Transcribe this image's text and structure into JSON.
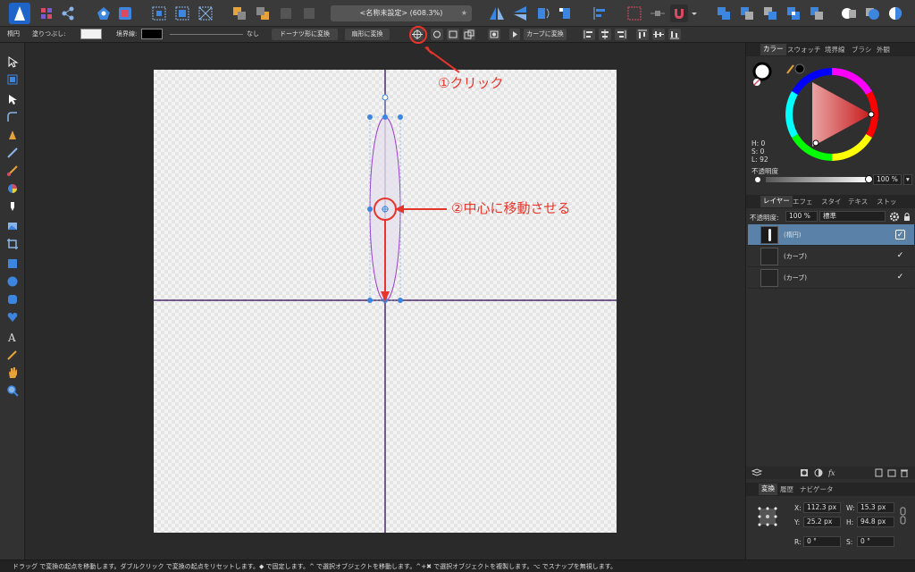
{
  "toolbar": {
    "document_title": "<名称未設定> (608.3%)",
    "star": "★"
  },
  "context": {
    "shape_label": "楕円",
    "fill_label": "塗りつぶし:",
    "stroke_label": "境界線:",
    "stroke_none": "なし",
    "donut_button": "ドーナツ形に変換",
    "pie_button": "扇形に変換",
    "curve_button": "カーブに変換",
    "fill_color": "#f2f2f2",
    "stroke_color": "#000000"
  },
  "annotations": {
    "step1": "①クリック",
    "step2": "②中心に移動させる",
    "color": "#e8352c"
  },
  "color_panel": {
    "tabs": [
      "カラー",
      "スウォッチ",
      "境界線",
      "ブラシ",
      "外観"
    ],
    "h": "H: 0",
    "s": "S: 0",
    "l": "L: 92",
    "opacity_label": "不透明度",
    "opacity_value": "100 %"
  },
  "layers_panel": {
    "tabs": [
      "レイヤー",
      "エフェ",
      "スタイ",
      "テキス",
      "ストッ"
    ],
    "opacity_label": "不透明度:",
    "opacity_value": "100 %",
    "blend_mode": "標準",
    "layers": [
      {
        "name": "(楕円)",
        "selected": true,
        "visible": "✓"
      },
      {
        "name": "(カーブ)",
        "selected": false,
        "visible": "✓"
      },
      {
        "name": "(カーブ)",
        "selected": false,
        "visible": "✓"
      }
    ]
  },
  "transform_panel": {
    "tabs": [
      "変換",
      "履歴",
      "ナビゲータ"
    ],
    "x_label": "X:",
    "x_value": "112.3 px",
    "y_label": "Y:",
    "y_value": "25.2 px",
    "w_label": "W:",
    "w_value": "15.3 px",
    "h_label": "H:",
    "h_value": "94.8 px",
    "r_label": "R:",
    "r_value": "0 °",
    "s_label": "S:",
    "s_value": "0 °"
  },
  "status": {
    "text": "ドラッグ で変換の起点を移動します。ダブルクリック で変換の起点をリセットします。◆ で固定します。^ で選択オブジェクトを移動します。^+✖ で選択オブジェクトを複製します。⌥ でスナップを無視します。"
  }
}
